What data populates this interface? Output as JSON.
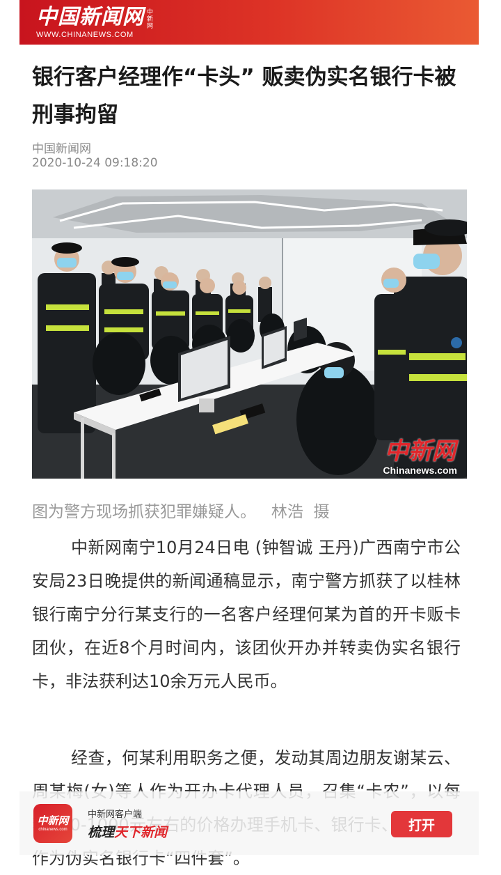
{
  "header": {
    "logo_text": "中国新闻网",
    "logo_side_text": "中新网",
    "logo_url": "WWW.CHINANEWS.COM"
  },
  "article": {
    "title": "银行客户经理作“卡头” 贩卖伪实名银行卡被刑事拘留",
    "source": "中国新闻网",
    "datetime": "2020-10-24 09:18:20",
    "photo": {
      "watermark_text": "中新网",
      "watermark_url": "Chinanews.com"
    },
    "caption": "图为警方现场抓获犯罪嫌疑人。   林浩  摄",
    "paragraphs": [
      "中新网南宁10月24日电 (钟智诚 王丹)广西南宁市公安局23日晚提供的新闻通稿显示，南宁警方抓获了以桂林银行南宁分行某支行的一名客户经理何某为首的开卡贩卡团伙，在近8个月时间内，该团伙开办并转卖伪实名银行卡，非法获利达10余万元人民币。",
      "经查，何某利用职务之便，发动其周边朋友谢某云、周某梅(女)等人作为开办卡代理人员，召集“卡农”，以每套800-1000元左右的价格办理手机卡、银行卡、U盾等，作为伪实名银行卡“四件套”。"
    ]
  },
  "app_banner": {
    "icon_text": "中新网",
    "icon_url": "chinanews.com",
    "app_name": "中新网客户端",
    "slogan_part1": "梳理",
    "slogan_part2": "天下新闻",
    "open_label": "打开"
  },
  "colors": {
    "brand_red": "#d8202a",
    "button_red": "#e3373a",
    "meta_gray": "#8a8a8a"
  }
}
